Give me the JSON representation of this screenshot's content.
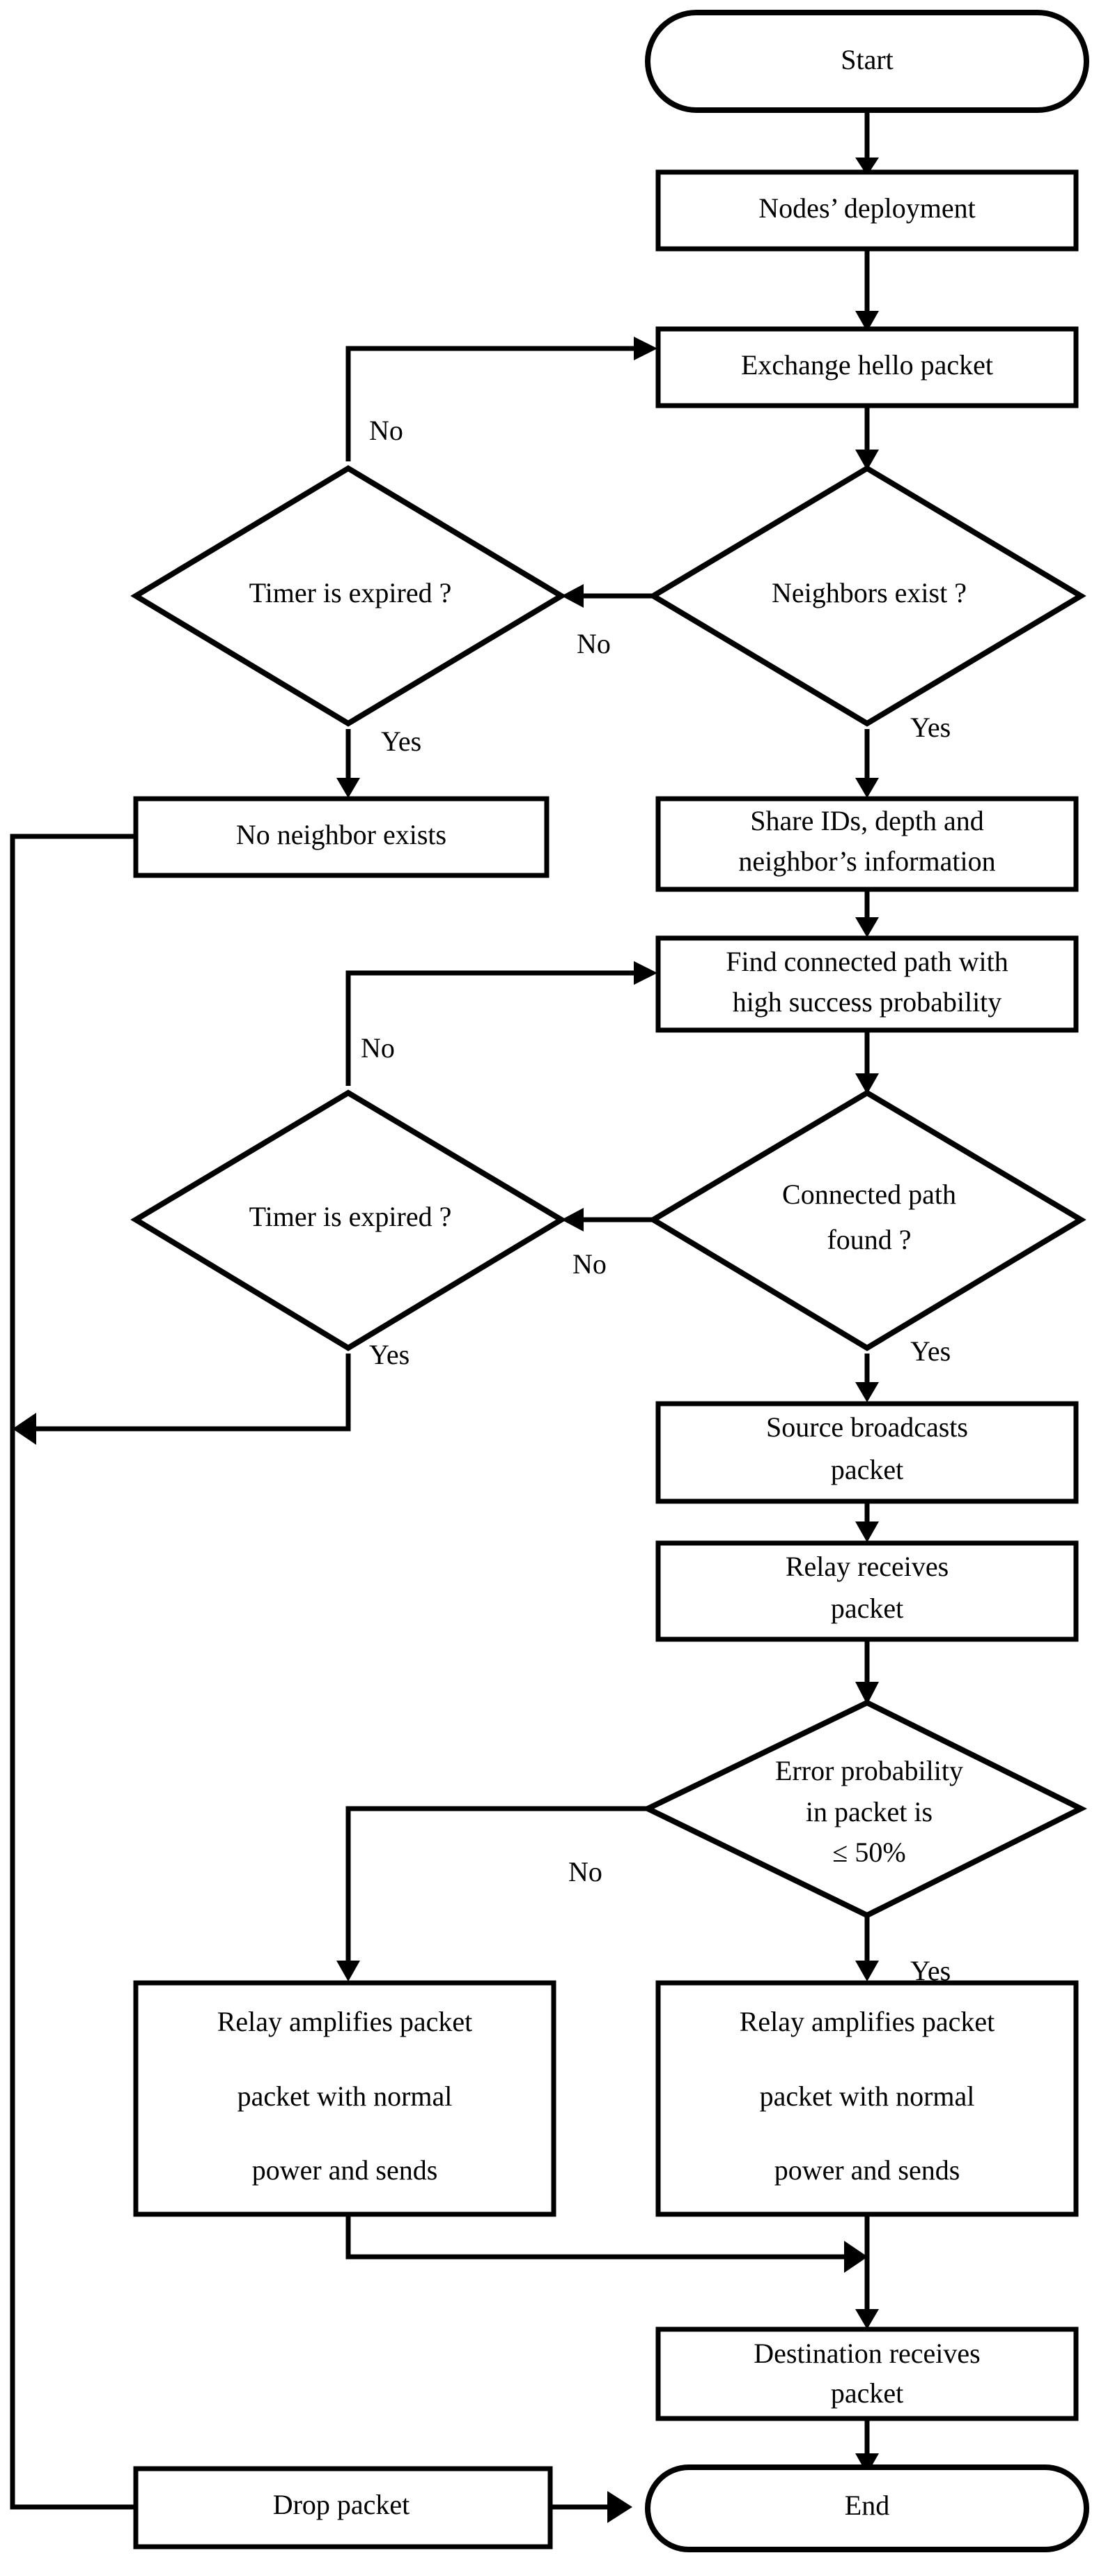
{
  "diagram": {
    "type": "flowchart",
    "title": "Routing protocol flowchart",
    "orientation": "top-to-bottom"
  },
  "nodes": {
    "start": {
      "label": "Start",
      "shape": "terminator"
    },
    "deployment": {
      "label": "Nodes’ deployment",
      "shape": "process"
    },
    "hello": {
      "label": "Exchange hello packet",
      "shape": "process"
    },
    "neighbors_exist": {
      "label": "Neighbors exist ?",
      "shape": "decision"
    },
    "timer1": {
      "label": "Timer is expired ?",
      "shape": "decision"
    },
    "no_neighbor": {
      "label": "No neighbor exists",
      "shape": "process"
    },
    "share_ids": {
      "line1": "Share IDs, depth and",
      "line2": "neighbor’s information",
      "shape": "process"
    },
    "find_path": {
      "line1": "Find connected path with",
      "line2": "high success probability",
      "shape": "process"
    },
    "timer2": {
      "label": "Timer is expired ?",
      "shape": "decision"
    },
    "path_found": {
      "line1": "Connected path",
      "line2": "found ?",
      "shape": "decision"
    },
    "source_broadcast": {
      "line1": "Source broadcasts",
      "line2": "packet",
      "shape": "process"
    },
    "relay_receives": {
      "line1": "Relay receives",
      "line2": "packet",
      "shape": "process"
    },
    "error_prob": {
      "line1": "Error probability",
      "line2": "in packet is",
      "line3": "≤ 50%",
      "shape": "decision"
    },
    "relay_amp_left": {
      "line1": "Relay amplifies packet",
      "line2": "packet with normal",
      "line3": "power and sends",
      "shape": "process"
    },
    "relay_amp_right": {
      "line1": "Relay amplifies packet",
      "line2": "packet with normal",
      "line3": "power and sends",
      "shape": "process"
    },
    "destination": {
      "line1": "Destination  receives",
      "line2": "packet",
      "shape": "process"
    },
    "drop_packet": {
      "label": "Drop packet",
      "shape": "process"
    },
    "end": {
      "label": "End",
      "shape": "terminator"
    }
  },
  "edge_labels": {
    "neighbors_no": "No",
    "neighbors_yes": "Yes",
    "timer1_no": "No",
    "timer1_yes": "Yes",
    "path_no": "No",
    "path_yes": "Yes",
    "timer2_no": "No",
    "timer2_yes": "Yes",
    "error_no": "No",
    "error_yes": "Yes"
  },
  "colors": {
    "stroke": "#000000",
    "fill": "#ffffff",
    "background": "#ffffff"
  }
}
